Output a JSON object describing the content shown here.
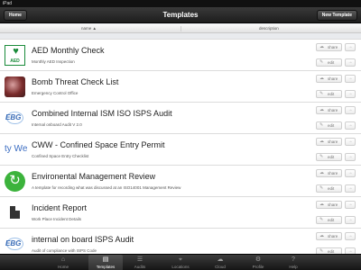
{
  "status_bar": {
    "carrier": "iPad",
    "time": "",
    "battery": ""
  },
  "nav": {
    "title": "Templates",
    "home_label": "Home",
    "new_label": "New Template"
  },
  "columns": {
    "name": "name ▲",
    "description": "description"
  },
  "templates": [
    {
      "title": "AED Monthly Check",
      "desc": "Monthly AED Inspection",
      "icon": "aed-icon",
      "thumb_text": "AED"
    },
    {
      "title": "Bomb Threat Check List",
      "desc": "Emergency Control Office",
      "icon": "bomb-photo-icon"
    },
    {
      "title": "Combined Internal ISM ISO ISPS Audit",
      "desc": "Internal onboard Audit V 2.0",
      "icon": "ebg-logo-icon"
    },
    {
      "title": "CWW - Confined Space Entry Permit",
      "desc": "Confined Space Entry Checklist",
      "icon": "text-logo-icon",
      "thumb_text": "ty We"
    },
    {
      "title": "Environental Management Review",
      "desc": "A template for recording what was discussed at an ISO14001 Management Review",
      "icon": "green-recycle-icon"
    },
    {
      "title": "Incident Report",
      "desc": "Work Place Incident Details",
      "icon": "document-icon"
    },
    {
      "title": "internal on board ISPS Audit",
      "desc": "Audit of compliance with ISPS Code",
      "icon": "ebg-logo-icon"
    }
  ],
  "row_buttons": {
    "share_label": "share",
    "edit_label": "edit"
  },
  "tabs": [
    {
      "label": "Home",
      "icon": "⌂"
    },
    {
      "label": "Templates",
      "icon": "▤"
    },
    {
      "label": "Audits",
      "icon": "☰"
    },
    {
      "label": "Locations",
      "icon": "⌖"
    },
    {
      "label": "Cloud",
      "icon": "☁"
    },
    {
      "label": "Profile",
      "icon": "⚙"
    },
    {
      "label": "Help",
      "icon": "?"
    }
  ],
  "colors": {
    "accent_green": "#1a8b3a",
    "nav_dark": "#1d1d1d"
  }
}
